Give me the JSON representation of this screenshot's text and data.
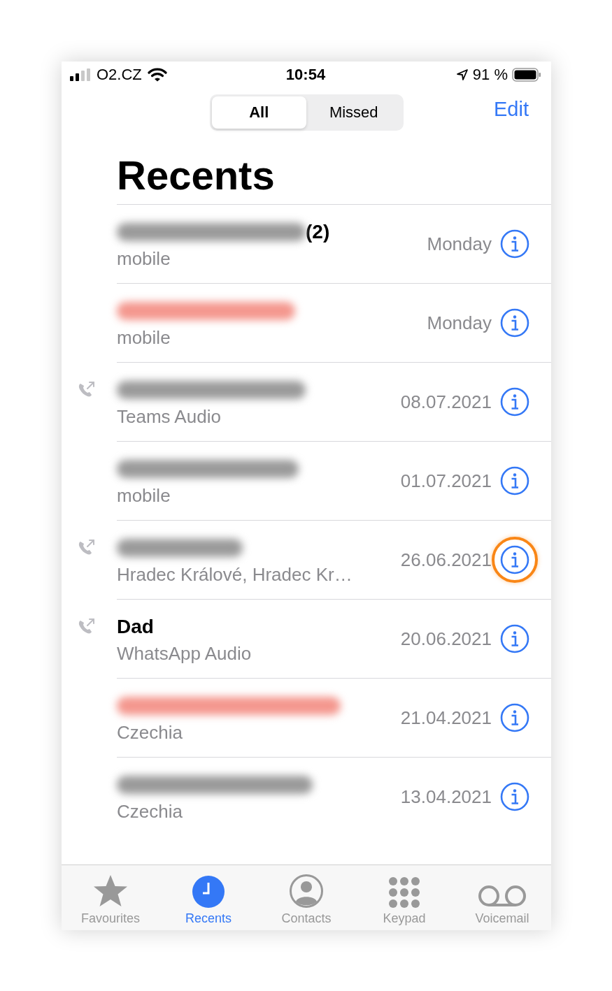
{
  "status_bar": {
    "carrier": "O2.CZ",
    "time": "10:54",
    "battery": "91 %"
  },
  "segments": [
    {
      "label": "All",
      "selected": true
    },
    {
      "label": "Missed",
      "selected": false
    }
  ],
  "edit": "Edit",
  "title": "Recents",
  "calls": [
    {
      "name_redacted": true,
      "count": "(2)",
      "missed": false,
      "outgoing": false,
      "subtitle": "mobile",
      "date": "Monday",
      "highlighted": false
    },
    {
      "name_redacted": true,
      "missed": true,
      "outgoing": false,
      "subtitle": "mobile",
      "date": "Monday",
      "highlighted": false
    },
    {
      "name_redacted": true,
      "missed": false,
      "outgoing": true,
      "subtitle": "Teams Audio",
      "date": "08.07.2021",
      "highlighted": false
    },
    {
      "name_redacted": true,
      "missed": false,
      "outgoing": false,
      "subtitle": "mobile",
      "date": "01.07.2021",
      "highlighted": false
    },
    {
      "name_redacted": true,
      "missed": false,
      "outgoing": true,
      "subtitle": "Hradec Králové, Hradec Kr…",
      "date": "26.06.2021",
      "highlighted": true
    },
    {
      "name": "Dad",
      "name_redacted": false,
      "missed": false,
      "outgoing": true,
      "subtitle": "WhatsApp Audio",
      "date": "20.06.2021",
      "highlighted": false
    },
    {
      "name_redacted": true,
      "missed": true,
      "outgoing": false,
      "subtitle": "Czechia",
      "date": "21.04.2021",
      "highlighted": false
    },
    {
      "name_redacted": true,
      "missed": false,
      "outgoing": false,
      "subtitle": "Czechia",
      "date": "13.04.2021",
      "highlighted": false
    }
  ],
  "tab_bar": [
    {
      "kind": "star",
      "label": "Favourites",
      "selected": false
    },
    {
      "kind": "clock",
      "label": "Recents",
      "selected": true
    },
    {
      "kind": "person",
      "label": "Contacts",
      "selected": false
    },
    {
      "kind": "keypad",
      "label": "Keypad",
      "selected": false
    },
    {
      "kind": "voicemail",
      "label": "Voicemail",
      "selected": false
    }
  ]
}
